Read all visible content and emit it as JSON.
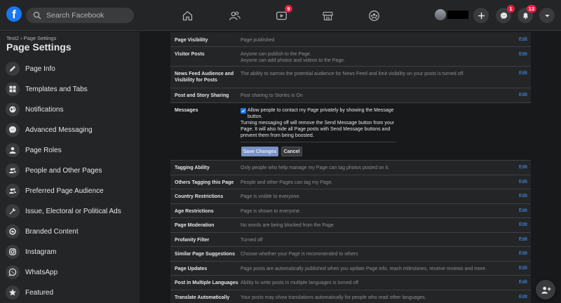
{
  "topbar": {
    "logo_letter": "f",
    "search_placeholder": "Search Facebook",
    "nav": [
      {
        "name": "home-icon",
        "badge": ""
      },
      {
        "name": "friends-icon",
        "badge": ""
      },
      {
        "name": "watch-icon",
        "badge": "9"
      },
      {
        "name": "marketplace-icon",
        "badge": ""
      },
      {
        "name": "groups-icon",
        "badge": ""
      }
    ],
    "messenger_badge": "1",
    "notifications_badge": "13"
  },
  "sidebar": {
    "breadcrumb": "Test2 › Page Settings",
    "title": "Page Settings",
    "items": [
      {
        "label": "Page Info",
        "icon": "pencil-icon"
      },
      {
        "label": "Templates and Tabs",
        "icon": "grid-icon"
      },
      {
        "label": "Notifications",
        "icon": "globe-icon"
      },
      {
        "label": "Advanced Messaging",
        "icon": "messenger-icon"
      },
      {
        "label": "Page Roles",
        "icon": "person-icon"
      },
      {
        "label": "People and Other Pages",
        "icon": "people-icon"
      },
      {
        "label": "Preferred Page Audience",
        "icon": "people-icon"
      },
      {
        "label": "Issue, Electoral or Political Ads",
        "icon": "wrench-icon"
      },
      {
        "label": "Branded Content",
        "icon": "handshake-icon"
      },
      {
        "label": "Instagram",
        "icon": "instagram-icon"
      },
      {
        "label": "WhatsApp",
        "icon": "whatsapp-icon"
      },
      {
        "label": "Featured",
        "icon": "star-icon"
      }
    ]
  },
  "settings": {
    "edit_label": "Edit",
    "rows_top": [
      {
        "label": "Page Visibility",
        "desc": "Page published"
      },
      {
        "label": "Visitor Posts",
        "desc": "Anyone can publish to the Page.\nAnyone can add photos and videos to the Page."
      },
      {
        "label": "News Feed Audience and Visibility for Posts",
        "desc": "The ability to narrow the potential audience for News Feed and limit visibility on your posts is turned off."
      },
      {
        "label": "Post and Story Sharing",
        "desc": "Post sharing to Stories is On"
      }
    ],
    "messages": {
      "label": "Messages",
      "checkbox_text": "Allow people to contact my Page privately by showing the Message button.",
      "info_text": "Turning messaging off will remove the Send Message button from your Page. It will also hide all Page posts with Send Message buttons and prevent them from being boosted.",
      "save_label": "Save Changes",
      "cancel_label": "Cancel"
    },
    "rows_bottom": [
      {
        "label": "Tagging Ability",
        "desc": "Only people who help manage my Page can tag photos posted on it."
      },
      {
        "label": "Others Tagging this Page",
        "desc": "People and other Pages can tag my Page."
      },
      {
        "label": "Country Restrictions",
        "desc": "Page is visible to everyone."
      },
      {
        "label": "Age Restrictions",
        "desc": "Page is shown to everyone."
      },
      {
        "label": "Page Moderation",
        "desc": "No words are being blocked from the Page."
      },
      {
        "label": "Profanity Filter",
        "desc": "Turned off"
      },
      {
        "label": "Similar Page Suggestions",
        "desc": "Choose whether your Page is recommended to others"
      },
      {
        "label": "Page Updates",
        "desc": "Page posts are automatically published when you update Page info, reach milestones, receive reviews and more."
      },
      {
        "label": "Post in Multiple Languages",
        "desc": "Ability to write posts in multiple languages is turned off"
      },
      {
        "label": "Translate Automatically",
        "desc": "Your posts may show translations automatically for people who read other languages."
      }
    ]
  }
}
